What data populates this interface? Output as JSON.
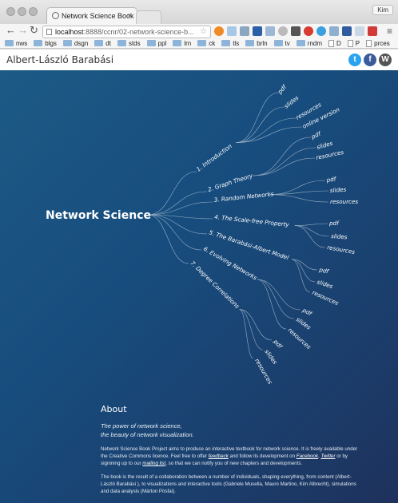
{
  "browser": {
    "tab_title": "Network Science Book",
    "tab_close": "×",
    "user": "Kim",
    "url_host": "localhost",
    "url_rest": ":8888/ccnr/02-network-science-b...",
    "bookmarks": [
      "nws",
      "blgs",
      "dsgn",
      "dt",
      "stds",
      "ppl",
      "lrn",
      "ck",
      "tls",
      "brln",
      "tv",
      "rndm",
      "D",
      "P",
      "prces"
    ]
  },
  "site": {
    "title": "Albert-László Barabási"
  },
  "tree": {
    "root": "Network Science",
    "chapters": [
      {
        "label": "1. Introduction",
        "leaves": [
          "pdf",
          "slides",
          "resources",
          "online version"
        ]
      },
      {
        "label": "2. Graph Theory",
        "leaves": [
          "pdf",
          "slides",
          "resources"
        ]
      },
      {
        "label": "3. Random Networks",
        "leaves": [
          "pdf",
          "slides",
          "resources"
        ]
      },
      {
        "label": "4. The Scale-free Property",
        "leaves": [
          "pdf",
          "slides",
          "resources"
        ]
      },
      {
        "label": "5. The Barabási-Albert Model",
        "leaves": [
          "pdf",
          "slides",
          "resources"
        ]
      },
      {
        "label": "6. Evolving Networks",
        "leaves": [
          "pdf",
          "slides",
          "resources"
        ]
      },
      {
        "label": "7. Degree Correlations",
        "leaves": [
          "pdf",
          "slides",
          "resources"
        ]
      }
    ]
  },
  "about": {
    "heading": "About",
    "tagline1": "The power of network science,",
    "tagline2": "the beauty of network visualization.",
    "p1_a": "Network Science Book Project aims to produce an interactive textbook for network science. It is freely available under the Creative Commons licence. Feel free to offer ",
    "p1_link1": "feedback",
    "p1_b": " and follow its development on ",
    "p1_link2": "Facebook",
    "p1_c": ", ",
    "p1_link3": "Twitter",
    "p1_d": " or by signining up to our ",
    "p1_link4": "mailing list",
    "p1_e": ", so that we can notify you of new chapters and developments.",
    "p2": "The book is the result of a collaboration between a number of individuals, shaping everything, from content (Albert-László Barabási ), to visualizations and interactive tools (Gabriele Musella, Mauro Martino, Kim Albrecht), simulations and data analysis (Márton Pósfai)."
  },
  "colors": {
    "twitter": "#2aa3ef",
    "facebook": "#3b5b9a",
    "wordpress": "#555555",
    "background": "#1b4a7a"
  }
}
